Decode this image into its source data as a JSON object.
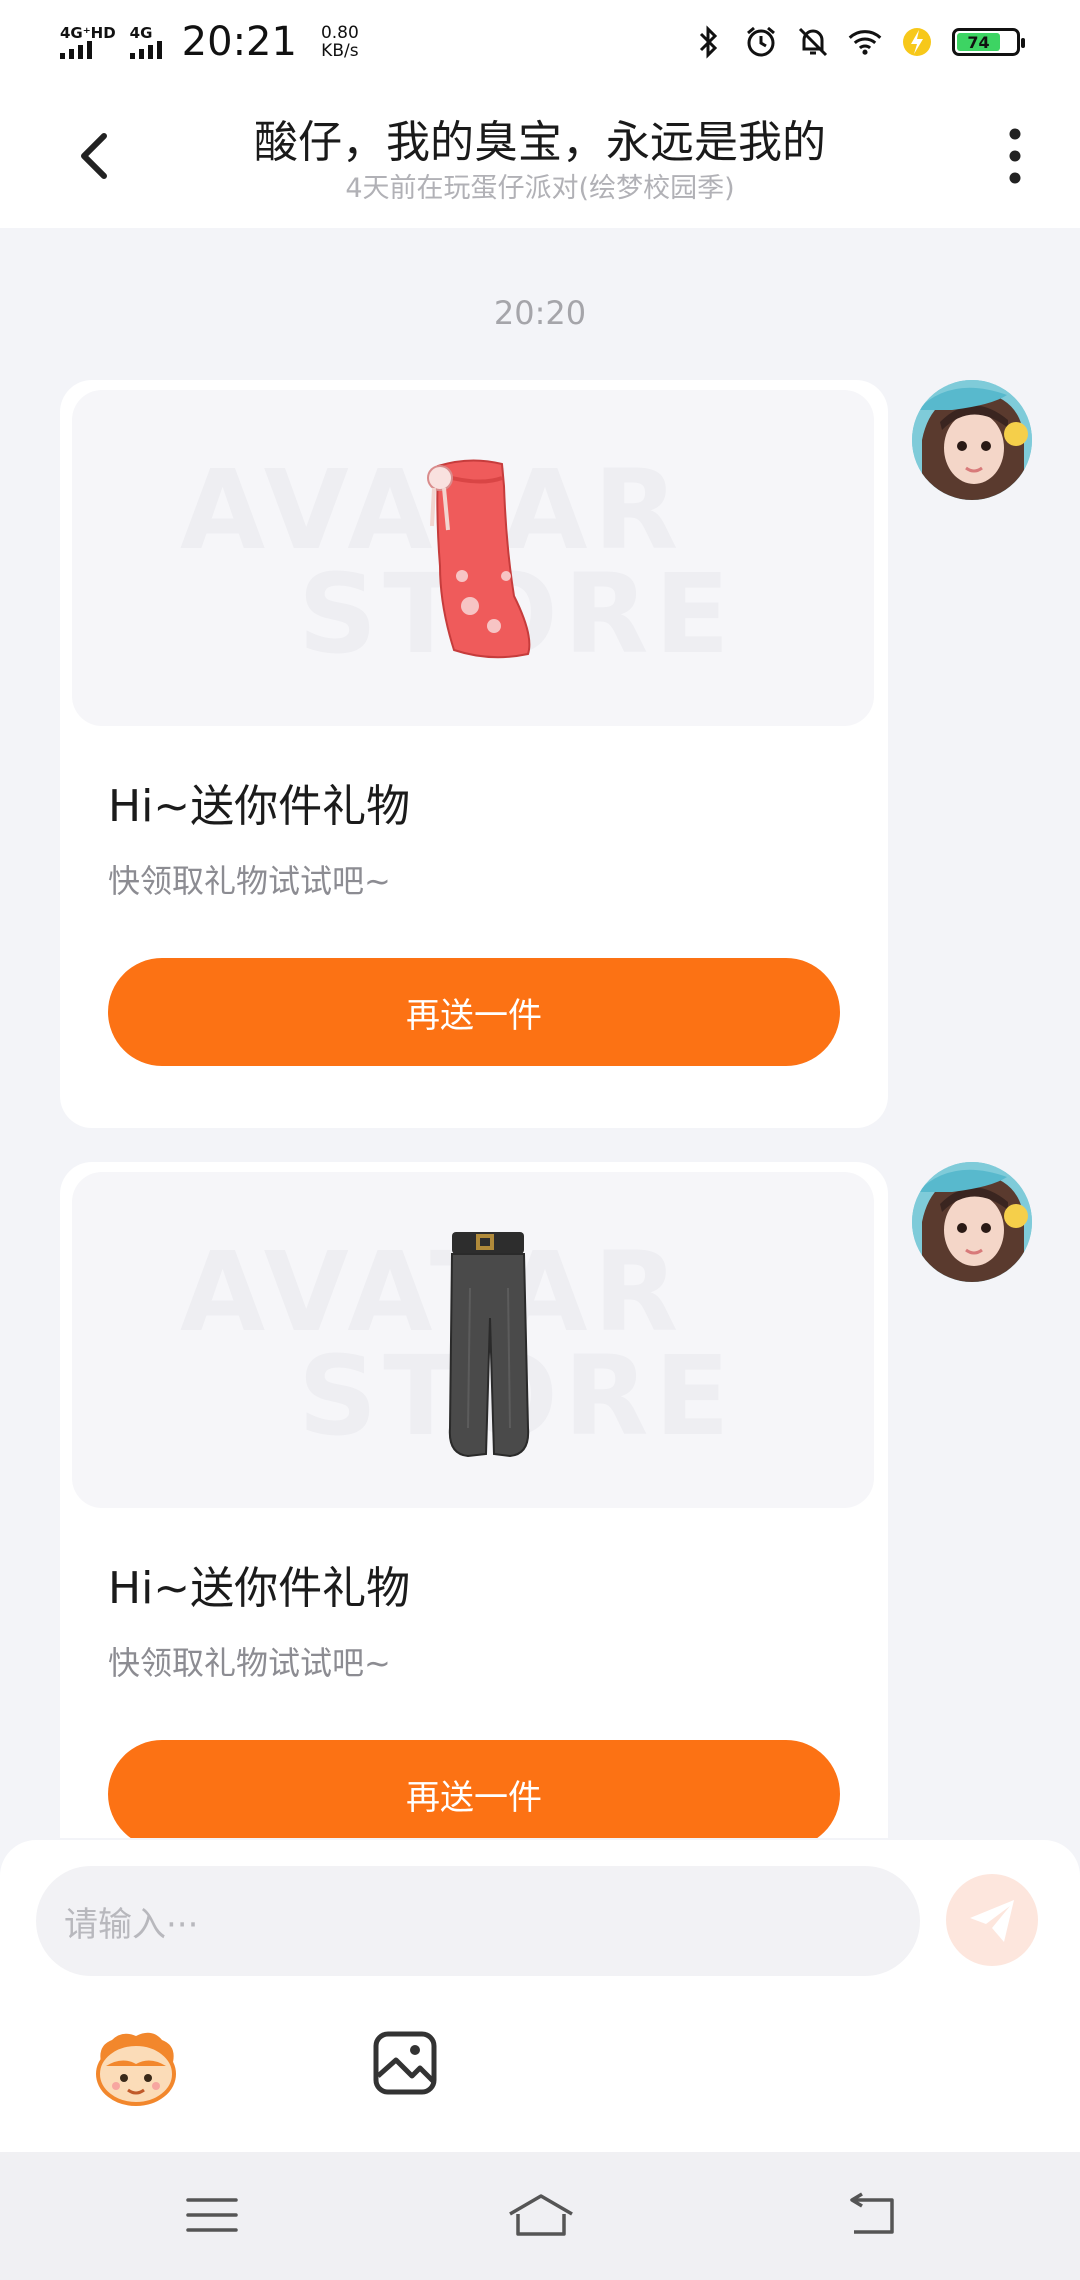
{
  "status_bar": {
    "signal1_label": "4G⁺HD",
    "signal2_label": "4G",
    "time": "20:21",
    "speed_value": "0.80",
    "speed_unit": "KB/s",
    "battery_percent": "74",
    "icons": [
      "bluetooth-icon",
      "alarm-icon",
      "mute-icon",
      "wifi-icon",
      "charging-icon",
      "battery-icon"
    ]
  },
  "header": {
    "title": "酸仔，我的臭宝，永远是我的",
    "subtitle": "4天前在玩蛋仔派对(绘梦校园季)"
  },
  "chat": {
    "timestamp": "20:20",
    "messages": [
      {
        "item": "red-skirt",
        "watermark_line1": "AVATAR",
        "watermark_line2": "STORE",
        "title": "Hi~送你件礼物",
        "desc": "快领取礼物试试吧~",
        "button": "再送一件"
      },
      {
        "item": "black-pants",
        "watermark_line1": "AVATAR",
        "watermark_line2": "STORE",
        "title": "Hi~送你件礼物",
        "desc": "快领取礼物试试吧~",
        "button": "再送一件"
      }
    ]
  },
  "input": {
    "placeholder": "请输入···"
  },
  "colors": {
    "accent": "#fc7214",
    "background": "#f3f4f8",
    "send_disabled": "#fde6dd"
  }
}
